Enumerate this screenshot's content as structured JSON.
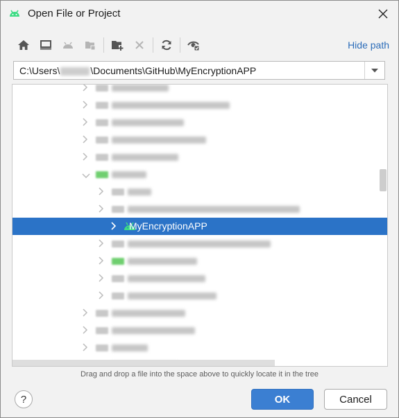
{
  "window": {
    "title": "Open File or Project"
  },
  "toolbar": {
    "buttons": [
      {
        "icon": "home-icon",
        "enabled": true
      },
      {
        "icon": "desktop-icon",
        "enabled": true
      },
      {
        "icon": "android-project-icon",
        "enabled": false
      },
      {
        "icon": "module-icon",
        "enabled": false
      },
      {
        "icon": "new-folder-icon",
        "enabled": true
      },
      {
        "icon": "delete-icon",
        "enabled": false
      },
      {
        "icon": "refresh-icon",
        "enabled": true
      },
      {
        "icon": "show-hidden-icon",
        "enabled": true
      }
    ],
    "hide_path_label": "Hide path"
  },
  "path": {
    "prefix": "C:\\Users\\",
    "suffix": "\\Documents\\GitHub\\MyEncryptionAPP"
  },
  "tree": {
    "selected_label": "MyEncryptionAPP"
  },
  "hint_text": "Drag and drop a file into the space above to quickly locate it in the tree",
  "buttons": {
    "help": "?",
    "ok": "OK",
    "cancel": "Cancel"
  },
  "colors": {
    "accent": "#2b73c7",
    "link": "#2b6cb9",
    "android_green": "#3ddc84"
  }
}
